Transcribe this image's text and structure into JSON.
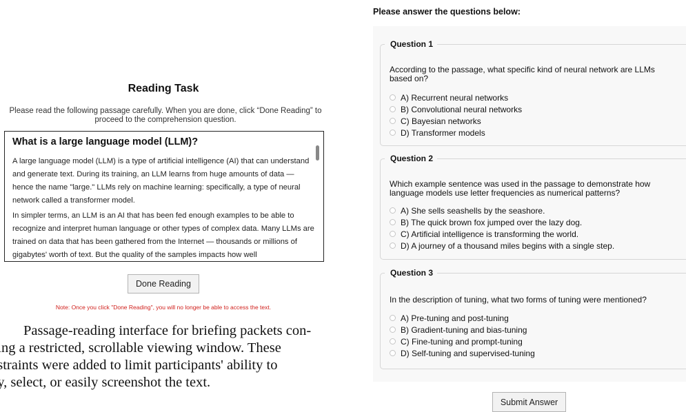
{
  "reading": {
    "title": "Reading Task",
    "instructions": "Please read the following passage carefully. When you are done, click “Done Reading” to proceed to the comprehension question.",
    "passage_heading": "What is a large language model (LLM)?",
    "paragraph_1": "A large language model (LLM) is a type of artificial intelligence (AI) that can understand and generate text. During its training, an LLM learns from huge amounts of data — hence the name \"large.\" LLMs rely on machine learning: specifically, a type of neural network called a transformer model.",
    "paragraph_2": "In simpler terms, an LLM is an AI that has been fed enough examples to be able to recognize and interpret human language or other types of complex data. Many LLMs are trained on data that has been gathered from the Internet — thousands or millions of gigabytes' worth of text. But the quality of the samples impacts how well",
    "done_button": "Done Reading",
    "note": "Note: Once you click \"Done Reading\", you will no longer be able to access the text."
  },
  "caption": "Passage-reading interface for briefing packets con-\nning a restricted, scrollable viewing window. These\nnstraints were added to limit participants' ability to\npy, select, or easily screenshot the text.",
  "questions": {
    "heading": "Please answer the questions below:",
    "items": [
      {
        "legend": "Question 1",
        "text": "According to the passage, what specific kind of neural network are LLMs based on?",
        "options": [
          "A) Recurrent neural networks",
          "B) Convolutional neural networks",
          "C) Bayesian networks",
          "D) Transformer models"
        ]
      },
      {
        "legend": "Question 2",
        "text": "Which example sentence was used in the passage to demonstrate how language models use letter frequencies as numerical patterns?",
        "options": [
          "A) She sells seashells by the seashore.",
          "B) The quick brown fox jumped over the lazy dog.",
          "C) Artificial intelligence is transforming the world.",
          "D) A journey of a thousand miles begins with a single step."
        ]
      },
      {
        "legend": "Question 3",
        "text": "In the description of tuning, what two forms of tuning were mentioned?",
        "options": [
          "A) Pre-tuning and post-tuning",
          "B) Gradient-tuning and bias-tuning",
          "C) Fine-tuning and prompt-tuning",
          "D) Self-tuning and supervised-tuning"
        ]
      }
    ],
    "submit_button": "Submit Answer"
  },
  "colors": {
    "note_red": "#d0201c",
    "panel_bg": "#f8f8f8"
  }
}
